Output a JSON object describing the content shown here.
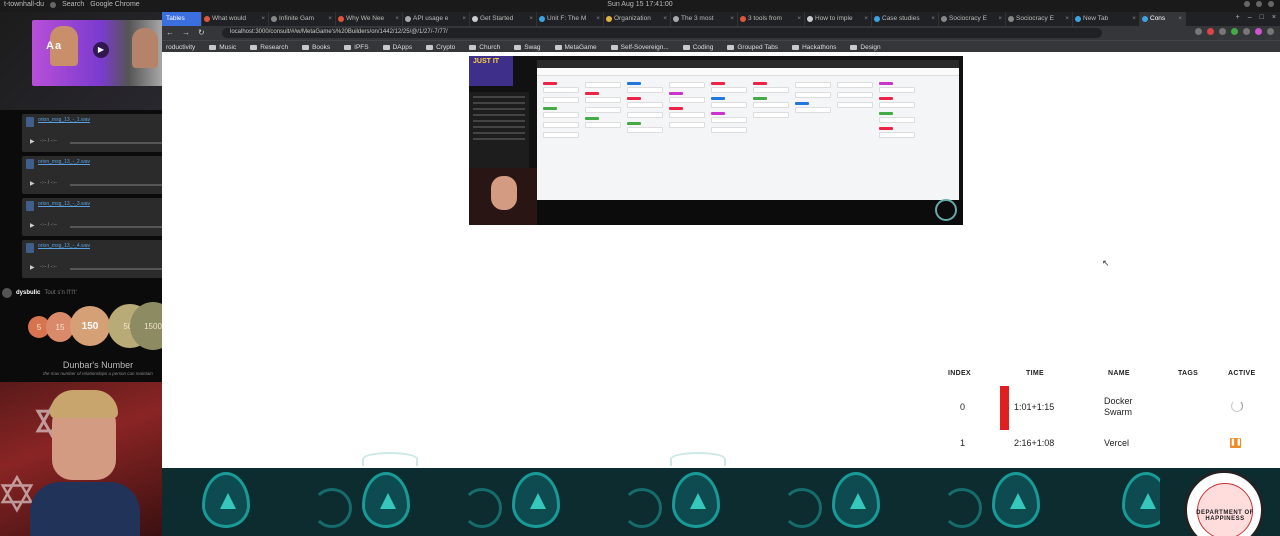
{
  "os_bar": {
    "workspace": "t-townhall-du",
    "search": "Search",
    "app_name": "Google Chrome",
    "clock": "Sun Aug 15  17:41:00"
  },
  "stream": {
    "top_cam_text": "Aa",
    "audio_files": [
      {
        "name": "orion_msg_13_-_1.wav",
        "time": "-:-- / -:--"
      },
      {
        "name": "orion_msg_13_-_2.wav",
        "time": "-:-- / -:--"
      },
      {
        "name": "orion_msg_13_-_3.wav",
        "time": "-:-- / -:--"
      },
      {
        "name": "orion_msg_13_-_4.wav",
        "time": "-:-- / -:--"
      }
    ],
    "chat": {
      "user": "dysbulic",
      "message": "Tout s'n l'l'l't'"
    },
    "dunbar": {
      "circles": [
        "5",
        "15",
        "150",
        "500",
        "1500"
      ],
      "title": "Dunbar's Number",
      "subtitle": "the max number of relationships a person can maintain"
    }
  },
  "browser": {
    "tabs": [
      {
        "label": "Tables"
      },
      {
        "label": "What would"
      },
      {
        "label": "Infinite Gam"
      },
      {
        "label": "Why We Nee"
      },
      {
        "label": "API usage e"
      },
      {
        "label": "Get Started"
      },
      {
        "label": "Unit F: The M"
      },
      {
        "label": "Organization"
      },
      {
        "label": "The 3 most"
      },
      {
        "label": "3 tools from"
      },
      {
        "label": "How to imple"
      },
      {
        "label": "Case studies"
      },
      {
        "label": "Sociocracy E"
      },
      {
        "label": "Sociocracy E"
      },
      {
        "label": "New Tab"
      },
      {
        "label": "Cons"
      }
    ],
    "url": "localhost:3000/consult/#/w/MetaGame's%20Builders/on/1442/12/25/@/1/27/-7/77/",
    "bookmarks": [
      "roductivity",
      "Music",
      "Research",
      "Books",
      "IPFS",
      "DApps",
      "Crypto",
      "Church",
      "Swag",
      "MetaGame",
      "Self-Sovereign...",
      "Coding",
      "Grouped Tabs",
      "Hackathons",
      "Design"
    ],
    "video_promo": "JUST IT",
    "queue": {
      "headers": {
        "index": "INDEX",
        "time": "TIME",
        "name": "NAME",
        "tags": "TAGS",
        "active": "ACTIVE"
      },
      "rows": [
        {
          "index": "0",
          "time": "1:01+1:15",
          "name": "Docker Swarm",
          "status": "loading"
        },
        {
          "index": "1",
          "time": "2:16+1:08",
          "name": "Vercel",
          "status": "paused"
        }
      ]
    }
  },
  "deco": {
    "seal_text": "DEPARTMENT OF HAPPINESS"
  },
  "colors": {
    "accent_red": "#e02020",
    "pause_orange": "#f08a24",
    "teal": "#1a9a96"
  }
}
